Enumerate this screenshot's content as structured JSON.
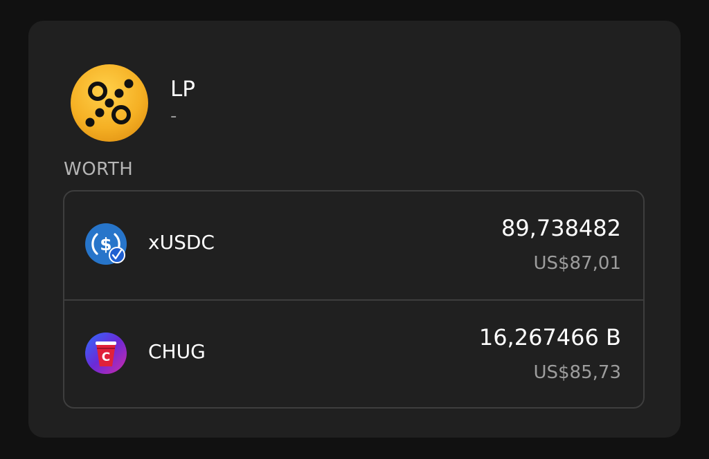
{
  "pool": {
    "name": "LP",
    "subtitle": "-",
    "icon": "percent-icon",
    "logo_color": "#f5b024"
  },
  "worth": {
    "label": "WORTH",
    "rows": [
      {
        "symbol": "xUSDC",
        "amount": "89,738482",
        "fiat": "US$87,01",
        "icon": "usdc-bridged-icon",
        "icon_color": "#2775ca"
      },
      {
        "symbol": "CHUG",
        "amount": "16,267466 B",
        "fiat": "US$85,73",
        "icon": "red-cup-icon",
        "icon_color": "#e0213a"
      }
    ]
  }
}
